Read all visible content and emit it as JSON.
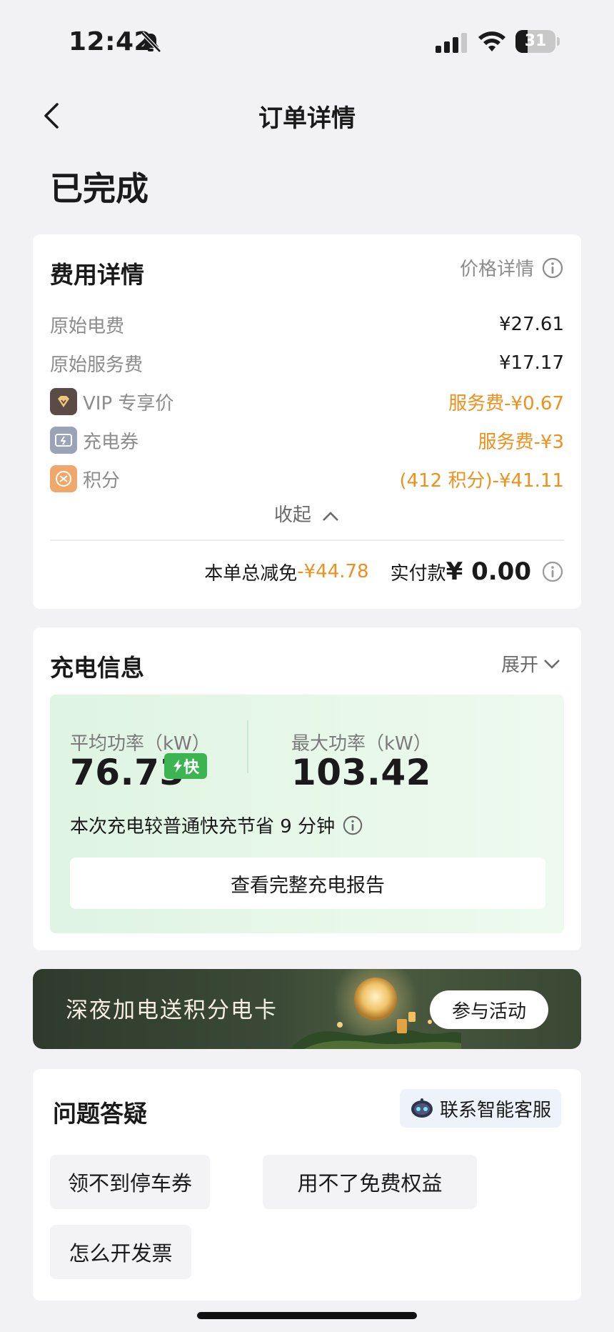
{
  "status_bar": {
    "time": "12:42",
    "battery_level": "31",
    "battery_fraction": 0.31,
    "icons": [
      "bell-slash-icon",
      "signal-icon",
      "wifi-icon",
      "battery-icon"
    ]
  },
  "nav": {
    "title": "订单详情",
    "back_icon": "chevron-left-icon"
  },
  "order_status": "已完成",
  "fee": {
    "title": "费用详情",
    "price_detail_link": "价格详情",
    "rows": [
      {
        "label": "原始电费",
        "value": "¥27.61"
      },
      {
        "label": "原始服务费",
        "value": "¥17.17"
      },
      {
        "label": "VIP 专享价",
        "value": "服务费-¥0.67",
        "icon": "vip-diamond-icon"
      },
      {
        "label": "充电券",
        "value": "服务费-¥3",
        "icon": "coupon-icon"
      },
      {
        "label": "积分",
        "value": "(412 积分)-¥41.11",
        "icon": "points-icon"
      }
    ],
    "collapse_label": "收起",
    "total_discount_label": "本单总减免",
    "total_discount_value": "-¥44.78",
    "paid_label": "实付款",
    "paid_amount": "¥ 0.00",
    "accent_color": "#f0901c"
  },
  "charge": {
    "title": "充电信息",
    "expand_label": "展开",
    "avg_power_label": "平均功率（kW）",
    "avg_power_value": "76.73",
    "fast_badge": "快",
    "max_power_label": "最大功率（kW）",
    "max_power_value": "103.42",
    "saving_text": "本次充电较普通快充节省 9 分钟",
    "report_button": "查看完整充电报告",
    "badge_color": "#3cb452"
  },
  "banner": {
    "text": "深夜加电送积分电卡",
    "button": "参与活动"
  },
  "faq": {
    "title": "问题答疑",
    "agent_button": "联系智能客服",
    "chips": [
      "领不到停车券",
      "用不了免费权益",
      "怎么开发票"
    ]
  }
}
